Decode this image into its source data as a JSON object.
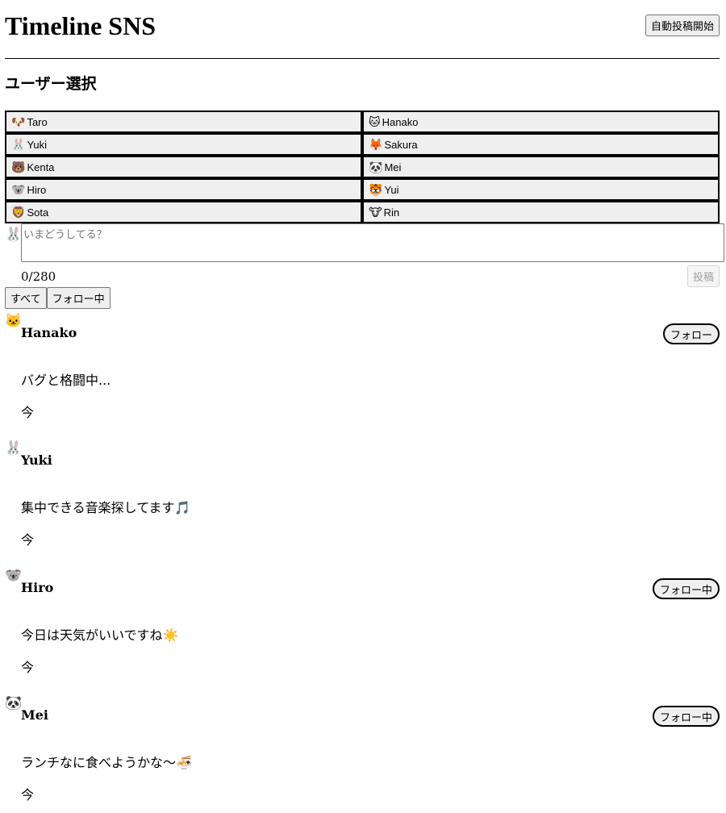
{
  "app": {
    "title": "Timeline SNS",
    "auto_post_label": "自動投稿開始"
  },
  "user_select": {
    "heading": "ユーザー選択",
    "users": [
      {
        "icon": "🐶",
        "icon_name": "dog-icon",
        "name": "Taro"
      },
      {
        "icon": "🐱",
        "icon_name": "cat-icon",
        "name": "Hanako"
      },
      {
        "icon": "🐰",
        "icon_name": "rabbit-icon",
        "name": "Yuki"
      },
      {
        "icon": "🦊",
        "icon_name": "fox-icon",
        "name": "Sakura"
      },
      {
        "icon": "🐻",
        "icon_name": "bear-icon",
        "name": "Kenta"
      },
      {
        "icon": "🐼",
        "icon_name": "panda-icon",
        "name": "Mei"
      },
      {
        "icon": "🐨",
        "icon_name": "koala-icon",
        "name": "Hiro"
      },
      {
        "icon": "🐯",
        "icon_name": "tiger-icon",
        "name": "Yui"
      },
      {
        "icon": "🦁",
        "icon_name": "lion-icon",
        "name": "Sota"
      },
      {
        "icon": "🐮",
        "icon_name": "cow-icon",
        "name": "Rin"
      }
    ]
  },
  "compose": {
    "avatar": "🐰",
    "avatar_name": "rabbit-icon",
    "placeholder": "いまどうしてる？",
    "value": "",
    "char_count": "0/280",
    "post_label": "投稿"
  },
  "filters": {
    "all_label": "すべて",
    "following_label": "フォロー中"
  },
  "posts": [
    {
      "avatar": "🐱",
      "avatar_name": "cat-icon",
      "name": "Hanako",
      "follow_label": "フォロー",
      "text": "バグと格闘中...",
      "time": "今"
    },
    {
      "avatar": "🐰",
      "avatar_name": "rabbit-icon",
      "name": "Yuki",
      "follow_label": "",
      "text": "集中できる音楽探してます🎵",
      "time": "今"
    },
    {
      "avatar": "🐨",
      "avatar_name": "koala-icon",
      "name": "Hiro",
      "follow_label": "フォロー中",
      "text": "今日は天気がいいですね☀️",
      "time": "今"
    },
    {
      "avatar": "🐼",
      "avatar_name": "panda-icon",
      "name": "Mei",
      "follow_label": "フォロー中",
      "text": "ランチなに食べようかな〜🍜",
      "time": "今"
    }
  ]
}
